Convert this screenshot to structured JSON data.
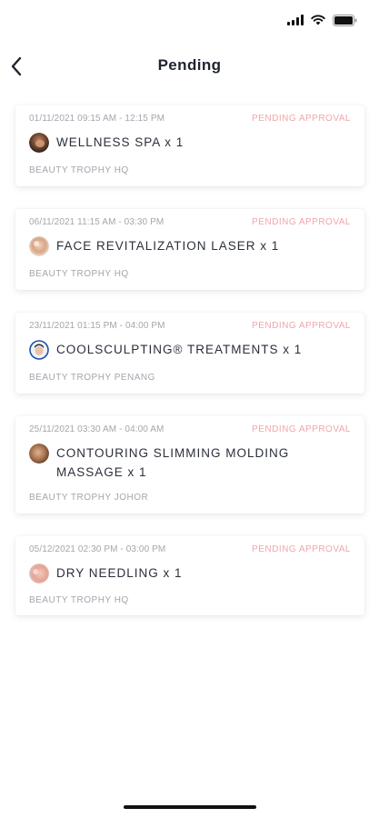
{
  "header": {
    "title": "Pending"
  },
  "bookings": [
    {
      "time": "01/11/2021 09:15 AM - 12:15 PM",
      "status": "PENDING APPROVAL",
      "service": "WELLNESS SPA x 1",
      "branch": "BEAUTY TROPHY HQ"
    },
    {
      "time": "06/11/2021 11:15 AM - 03:30 PM",
      "status": "PENDING APPROVAL",
      "service": "FACE REVITALIZATION LASER x 1",
      "branch": "BEAUTY TROPHY HQ"
    },
    {
      "time": "23/11/2021 01:15 PM - 04:00 PM",
      "status": "PENDING APPROVAL",
      "service": "COOLSCULPTING® TREATMENTS x 1",
      "branch": "BEAUTY TROPHY PENANG"
    },
    {
      "time": "25/11/2021 03:30 AM - 04:00 AM",
      "status": "PENDING APPROVAL",
      "service": "CONTOURING SLIMMING MOLDING MASSAGE x 1",
      "branch": "BEAUTY TROPHY JOHOR"
    },
    {
      "time": "05/12/2021 02:30 PM - 03:00 PM",
      "status": "PENDING APPROVAL",
      "service": "DRY NEEDLING x 1",
      "branch": "BEAUTY TROPHY HQ"
    }
  ],
  "colors": {
    "status_text": "#f2a6a6",
    "muted_text": "#a3a6ad",
    "primary_text": "#2b2f3a"
  },
  "icons": {
    "status_bar": [
      "signal-icon",
      "wifi-icon",
      "battery-icon"
    ],
    "back": "chevron-left-icon"
  }
}
